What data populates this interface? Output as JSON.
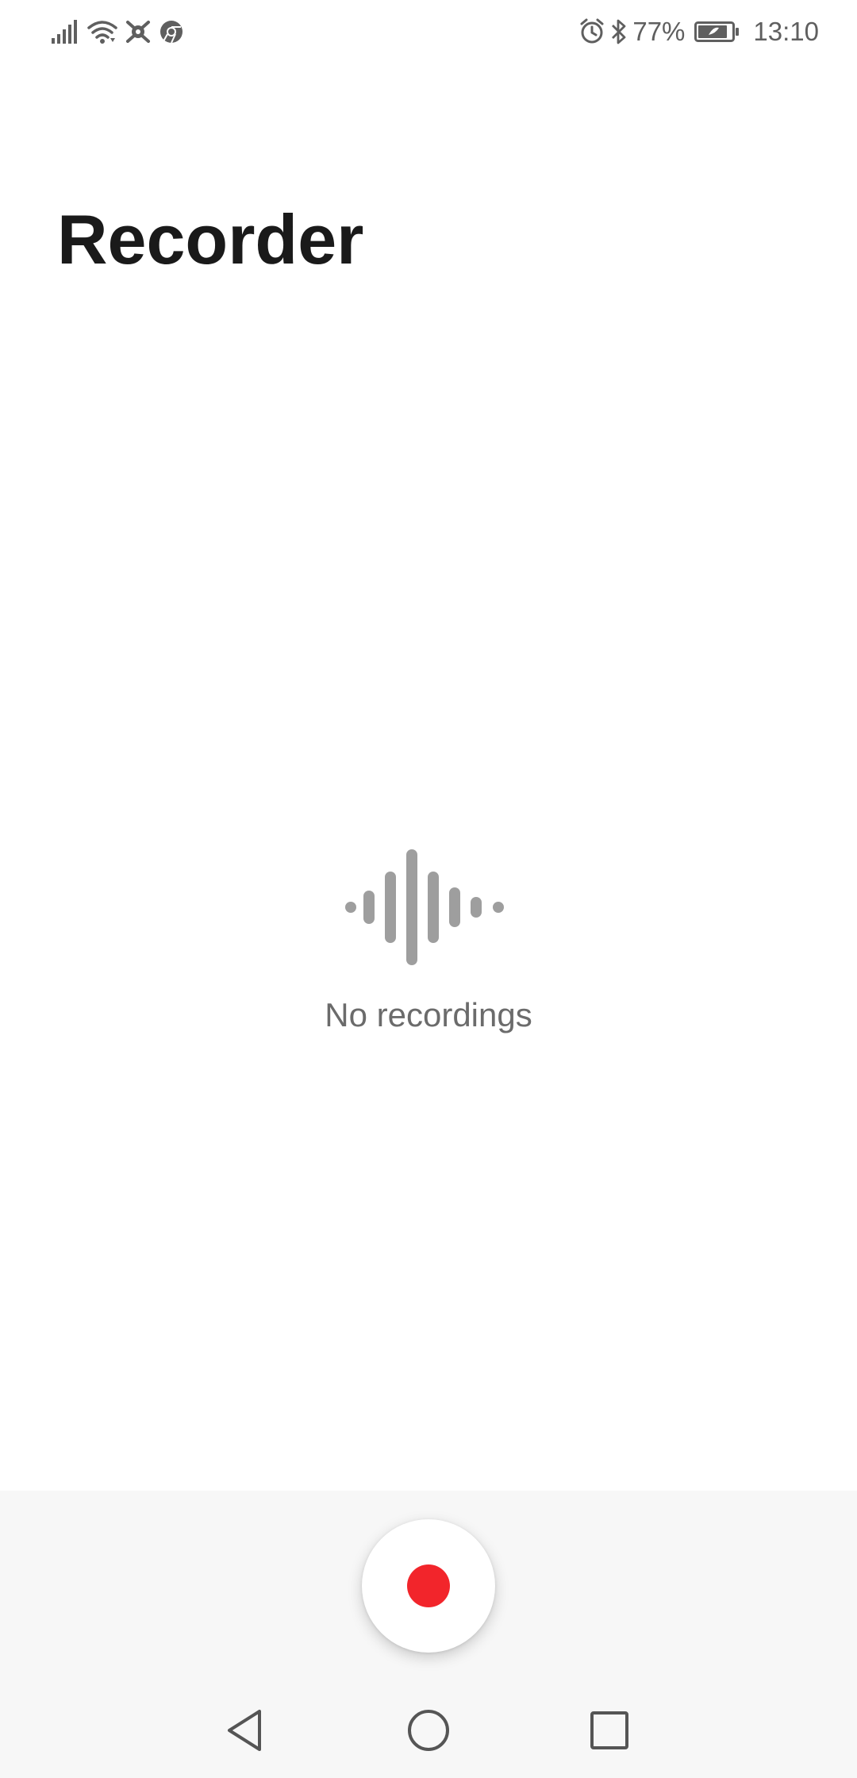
{
  "status_bar": {
    "battery_percent": "77%",
    "time": "13:10",
    "left_icons": [
      "signal-icon",
      "wifi-icon",
      "app-notification-icon",
      "chrome-icon"
    ],
    "right_icons": [
      "alarm-icon",
      "bluetooth-icon",
      "battery-icon"
    ]
  },
  "header": {
    "title": "Recorder"
  },
  "empty_state": {
    "icon": "waveform-icon",
    "message": "No recordings"
  },
  "controls": {
    "record_icon": "record-icon",
    "record_color": "#f2252b"
  },
  "nav_bar": {
    "items": [
      "back-icon",
      "home-icon",
      "recents-icon"
    ]
  }
}
